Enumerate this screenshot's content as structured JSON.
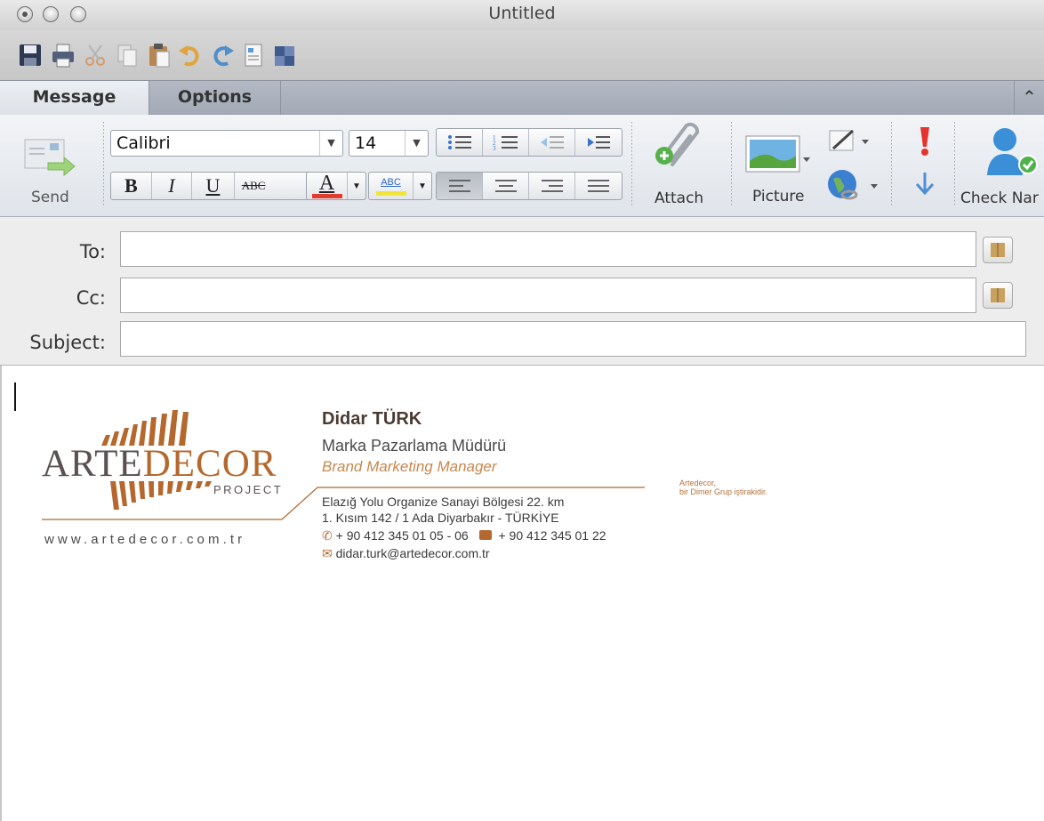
{
  "window": {
    "title": "Untitled"
  },
  "quick_toolbar": {
    "icons": [
      "save-icon",
      "print-icon",
      "cut-icon",
      "copy-icon",
      "paste-icon",
      "undo-icon",
      "redo-icon",
      "format-icon",
      "media-browser-icon"
    ]
  },
  "tabs": [
    {
      "label": "Message",
      "active": true
    },
    {
      "label": "Options",
      "active": false
    }
  ],
  "ribbon": {
    "send_label": "Send",
    "font_name": "Calibri",
    "font_size": "14",
    "bold": "B",
    "italic": "I",
    "underline": "U",
    "strike": "ABC",
    "font_color_label": "A",
    "highlight_label": "ABC",
    "attach_label": "Attach",
    "picture_label": "Picture",
    "check_names_label": "Check Nar",
    "colors": {
      "font_color": "#e23c2e",
      "highlight": "#f0e63a"
    }
  },
  "fields": {
    "to_label": "To:",
    "to_value": "",
    "cc_label": "Cc:",
    "cc_value": "",
    "subject_label": "Subject:",
    "subject_value": ""
  },
  "signature": {
    "logo_part1": "ARTE",
    "logo_part2": "DECOR",
    "logo_project": "PROJECT",
    "website": "www.artedecor.com.tr",
    "name": "Didar TÜRK",
    "title_tr": "Marka Pazarlama Müdürü",
    "title_en": "Brand Marketing Manager",
    "address1": "Elazığ Yolu Organize Sanayi Bölgesi 22. km",
    "address2": "1. Kısım 142 / 1 Ada Diyarbakır - TÜRKİYE",
    "phone": "+ 90 412 345 01 05 - 06",
    "fax": "+ 90 412 345 01 22",
    "email": "didar.turk@artedecor.com.tr",
    "side_note_line1": "Artedecor,",
    "side_note_line2": "bir Dimer Grup  iştirakidir.",
    "colors": {
      "brand_brown": "#b4682d",
      "brand_dark": "#5a5250"
    }
  }
}
